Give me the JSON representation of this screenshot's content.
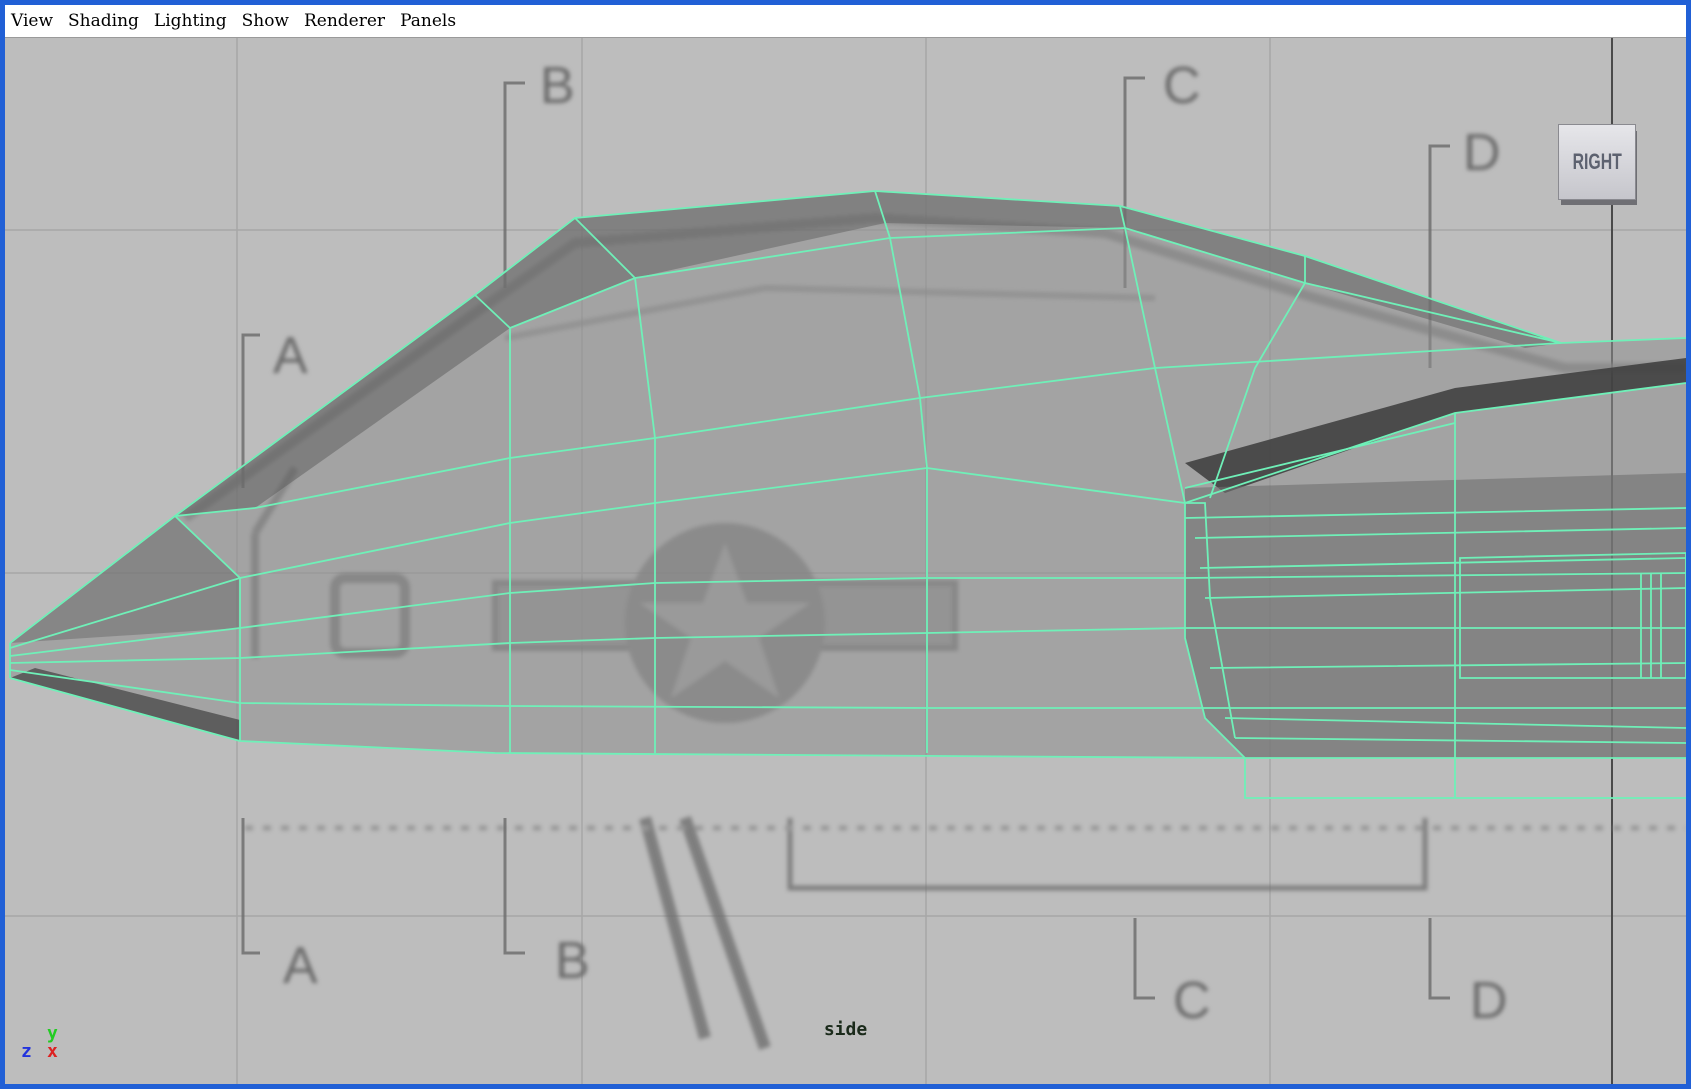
{
  "window": {
    "accent_color": "#2160d6"
  },
  "menubar": {
    "items": [
      "View",
      "Shading",
      "Lighting",
      "Show",
      "Renderer",
      "Panels"
    ]
  },
  "viewport": {
    "camera_label": "side",
    "view_cube_label": "RIGHT",
    "wireframe_color": "#6ff0b8",
    "blueprint_labels": {
      "a_top": "A",
      "b_top": "B",
      "c_top": "C",
      "d_top": "D",
      "a_bottom": "A",
      "b_bottom": "B",
      "c_bottom": "C",
      "d_bottom": "D"
    },
    "axis_gizmo": {
      "y": "y",
      "z": "z",
      "x": "x"
    }
  }
}
